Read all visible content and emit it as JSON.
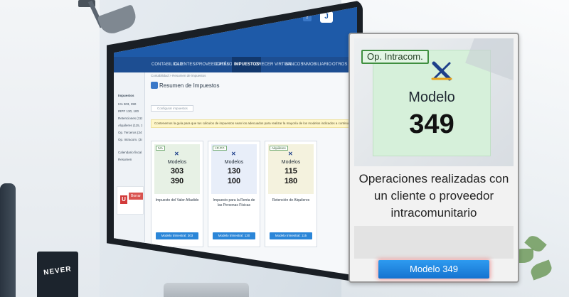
{
  "background": {
    "mug_text": "NEVER"
  },
  "app": {
    "topbar": {
      "help_label": "?",
      "brand_label": "J"
    },
    "nav_items": [
      "Contabilidad",
      "Clientes/Proveedores",
      "Catálogo",
      "Impuestos",
      "Crecer Virtual",
      "Bancos",
      "Inmobiliario",
      "Otros"
    ],
    "sidebar": {
      "lines": [
        "Impuestos",
        "IVA 303, 390",
        "IRPF 130, 100",
        "Retenciones (111, 190)",
        "Alquileres (115, 180)",
        "Op. Terceros (347)",
        "Op. Intracom. (349)",
        "Calendario fiscal",
        "Resumen"
      ],
      "user_initial": "U",
      "exit_label": "Borrar"
    },
    "main": {
      "breadcrumb": "Contabilidad > Resumen de impuestos",
      "title": "Resumen de Impuestos",
      "search_placeholder": "Configurar impuestos",
      "note": "Contenemos la guía para que tus cálculos de impuestos sean los adecuados para realizar la mayoría de los modelos indicados a continuación.",
      "cards": [
        {
          "tag": "IVA",
          "model_label": "Modelos",
          "numbers": [
            "303",
            "390"
          ],
          "description": "Impuesto del Valor Añadido",
          "button": "Modelo trimestral: 303"
        },
        {
          "tag": "I.R.P.F.",
          "model_label": "Modelos",
          "numbers": [
            "130",
            "100"
          ],
          "description": "Impuesto para la Renta de las Personas Físicas",
          "button": "Modelo trimestral: 130"
        },
        {
          "tag": "Alquileres",
          "model_label": "Modelos",
          "numbers": [
            "115",
            "180"
          ],
          "description": "Retención de Alquileres",
          "button": "Modelo trimestral: 115"
        }
      ]
    }
  },
  "promo": {
    "tag": "Op. Intracom.",
    "model_label": "Modelo",
    "model_number": "349",
    "description": "Operaciones realizadas con un cliente o proveedor intracomunitario",
    "button_label": "Modelo 349"
  },
  "colors": {
    "brand_blue": "#1e5aa8",
    "button_blue": "#1e86e0",
    "tile_green": "#d6f0da",
    "tag_border_green": "#3f8f3f",
    "button_glow": "#ee5050"
  }
}
